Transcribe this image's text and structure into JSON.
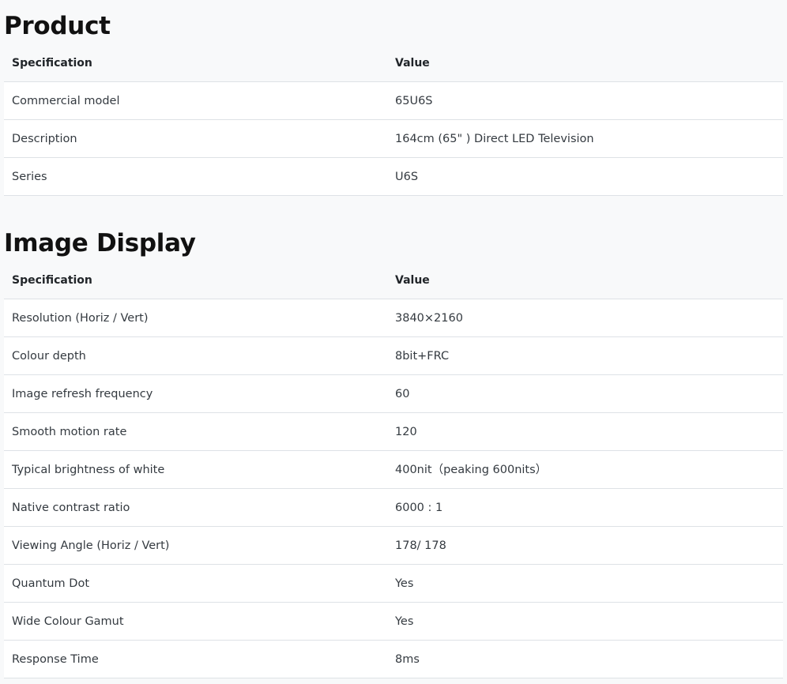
{
  "sections": [
    {
      "title": "Product",
      "header": {
        "spec": "Specification",
        "value": "Value"
      },
      "rows": [
        {
          "spec": "Commercial model",
          "value": "65U6S"
        },
        {
          "spec": "Description",
          "value": "164cm (65\" ) Direct LED Television"
        },
        {
          "spec": "Series",
          "value": "U6S"
        }
      ]
    },
    {
      "title": "Image Display",
      "header": {
        "spec": "Specification",
        "value": "Value"
      },
      "rows": [
        {
          "spec": "Resolution (Horiz / Vert)",
          "value": "3840×2160"
        },
        {
          "spec": "Colour depth",
          "value": "8bit+FRC"
        },
        {
          "spec": "Image refresh frequency",
          "value": "60"
        },
        {
          "spec": "Smooth motion rate",
          "value": "120"
        },
        {
          "spec": "Typical brightness of white",
          "value": "400nit（peaking 600nits）"
        },
        {
          "spec": "Native contrast ratio",
          "value": "6000 : 1"
        },
        {
          "spec": "Viewing Angle (Horiz / Vert)",
          "value": "178/ 178"
        },
        {
          "spec": "Quantum Dot",
          "value": "Yes"
        },
        {
          "spec": "Wide Colour Gamut",
          "value": "Yes"
        },
        {
          "spec": "Response Time",
          "value": "8ms"
        }
      ]
    }
  ]
}
